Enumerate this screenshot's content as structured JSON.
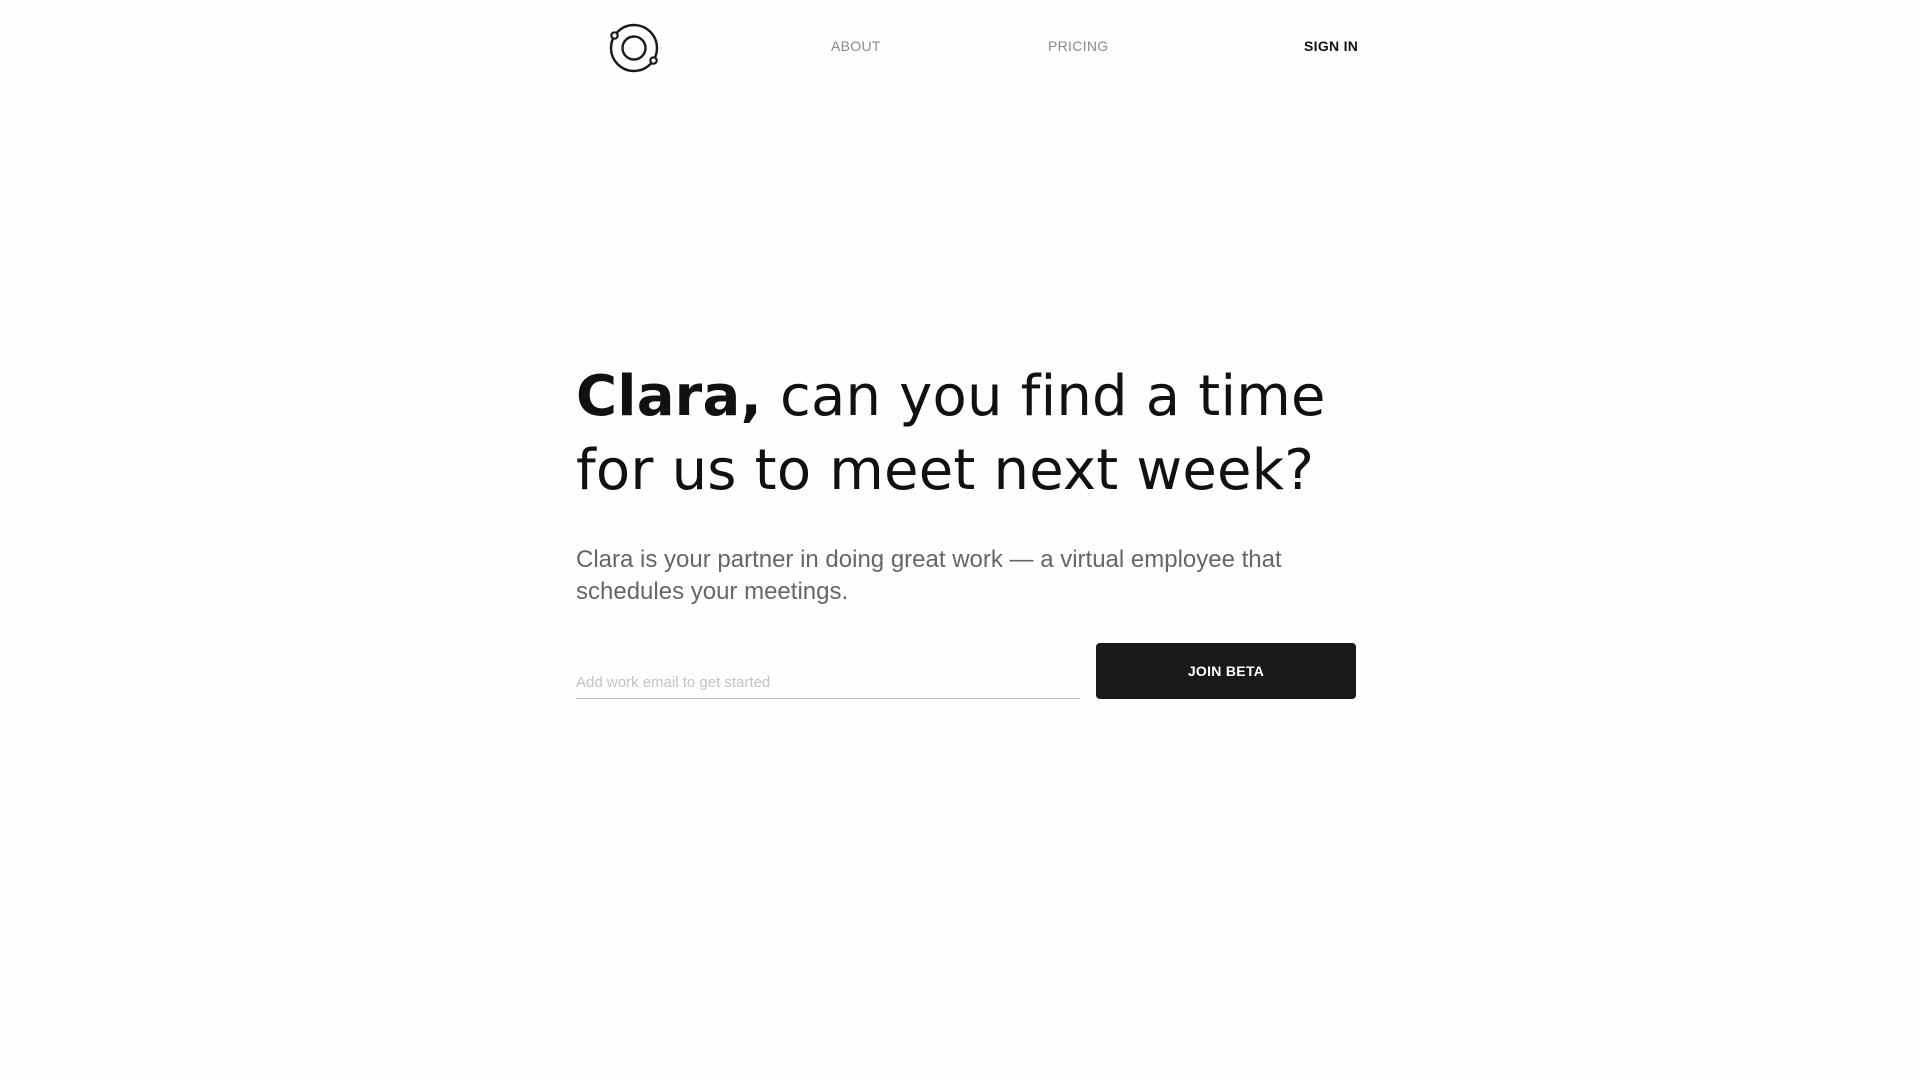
{
  "header": {
    "logo_icon": "clara-orbit-logo-icon",
    "nav": {
      "about": "ABOUT",
      "pricing": "PRICING",
      "sign_in": "SIGN IN"
    }
  },
  "hero": {
    "headline_bold": "Clara,",
    "headline_rest": " can you find a time for us to meet next week?",
    "subhead": "Clara is your partner in doing great work — a virtual employee that schedules your meetings."
  },
  "signup": {
    "email_placeholder": "Add work email to get started",
    "email_value": "",
    "button_label": "JOIN BETA"
  },
  "colors": {
    "background": "#fffefd",
    "button": "#1b1918",
    "nav_muted": "#8a8a8a",
    "text": "#111111"
  }
}
